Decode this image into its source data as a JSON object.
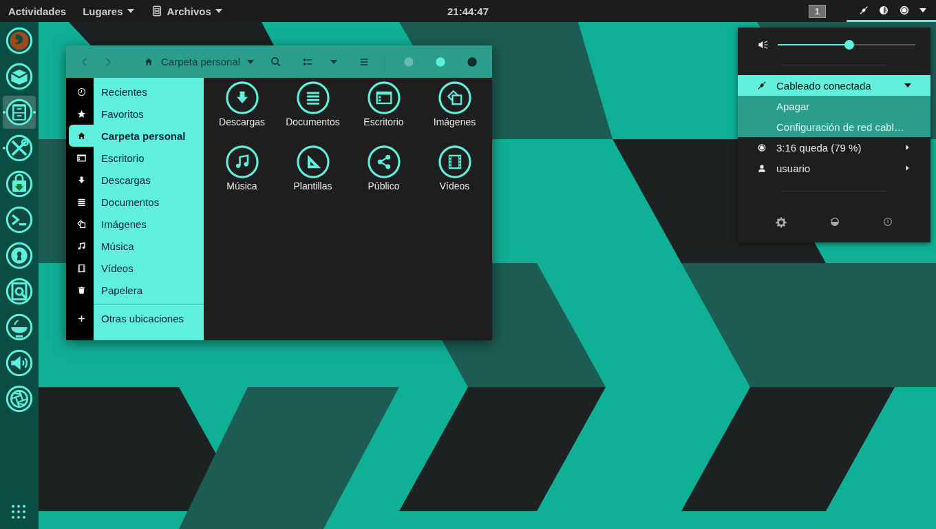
{
  "top_bar": {
    "activities": "Actividades",
    "places_menu": "Lugares",
    "app_menu": "Archivos",
    "clock": "21:44:47",
    "workspace": "1"
  },
  "dock": {
    "apps": [
      {
        "kind": "globe",
        "running": false,
        "selected": false
      },
      {
        "kind": "envelope",
        "running": false,
        "selected": false
      },
      {
        "kind": "drawer",
        "running": true,
        "selected": true
      },
      {
        "kind": "tools",
        "running": true,
        "selected": false
      },
      {
        "kind": "bag",
        "running": false,
        "selected": false
      },
      {
        "kind": "terminal",
        "running": false,
        "selected": false
      },
      {
        "kind": "keyhole",
        "running": false,
        "selected": false
      },
      {
        "kind": "magnifier",
        "running": false,
        "selected": false
      },
      {
        "kind": "lamp",
        "running": false,
        "selected": false
      },
      {
        "kind": "speaker",
        "running": false,
        "selected": false
      },
      {
        "kind": "aperture",
        "running": false,
        "selected": false
      }
    ]
  },
  "files": {
    "location": "Carpeta personal",
    "sidebar": [
      {
        "kind": "clock",
        "label": "Recientes",
        "selected": false
      },
      {
        "kind": "star",
        "label": "Favoritos",
        "selected": false
      },
      {
        "kind": "home",
        "label": "Carpeta personal",
        "selected": true
      },
      {
        "kind": "window",
        "label": "Escritorio",
        "selected": false
      },
      {
        "kind": "download",
        "label": "Descargas",
        "selected": false
      },
      {
        "kind": "list",
        "label": "Documentos",
        "selected": false
      },
      {
        "kind": "image",
        "label": "Imágenes",
        "selected": false
      },
      {
        "kind": "music",
        "label": "Música",
        "selected": false
      },
      {
        "kind": "film",
        "label": "Vídeos",
        "selected": false
      },
      {
        "kind": "trash",
        "label": "Papelera",
        "selected": false
      }
    ],
    "other_locations": {
      "kind": "plus",
      "label": "Otras ubicaciones"
    },
    "items": [
      {
        "kind": "download",
        "label": "Descargas"
      },
      {
        "kind": "list",
        "label": "Documentos"
      },
      {
        "kind": "window",
        "label": "Escritorio"
      },
      {
        "kind": "image",
        "label": "Imágenes"
      },
      {
        "kind": "music",
        "label": "Música"
      },
      {
        "kind": "ruler",
        "label": "Plantillas"
      },
      {
        "kind": "share",
        "label": "Público"
      },
      {
        "kind": "film",
        "label": "Vídeos"
      }
    ]
  },
  "system_menu": {
    "volume": {
      "level": 0.52
    },
    "network": {
      "label": "Cableado conectada",
      "expanded": true,
      "actions": [
        "Apagar",
        "Configuración de red cabl…"
      ]
    },
    "rows": [
      {
        "kind": "battery",
        "label": "3:16 queda (79 %)"
      },
      {
        "kind": "user",
        "label": "usuario"
      }
    ]
  }
}
